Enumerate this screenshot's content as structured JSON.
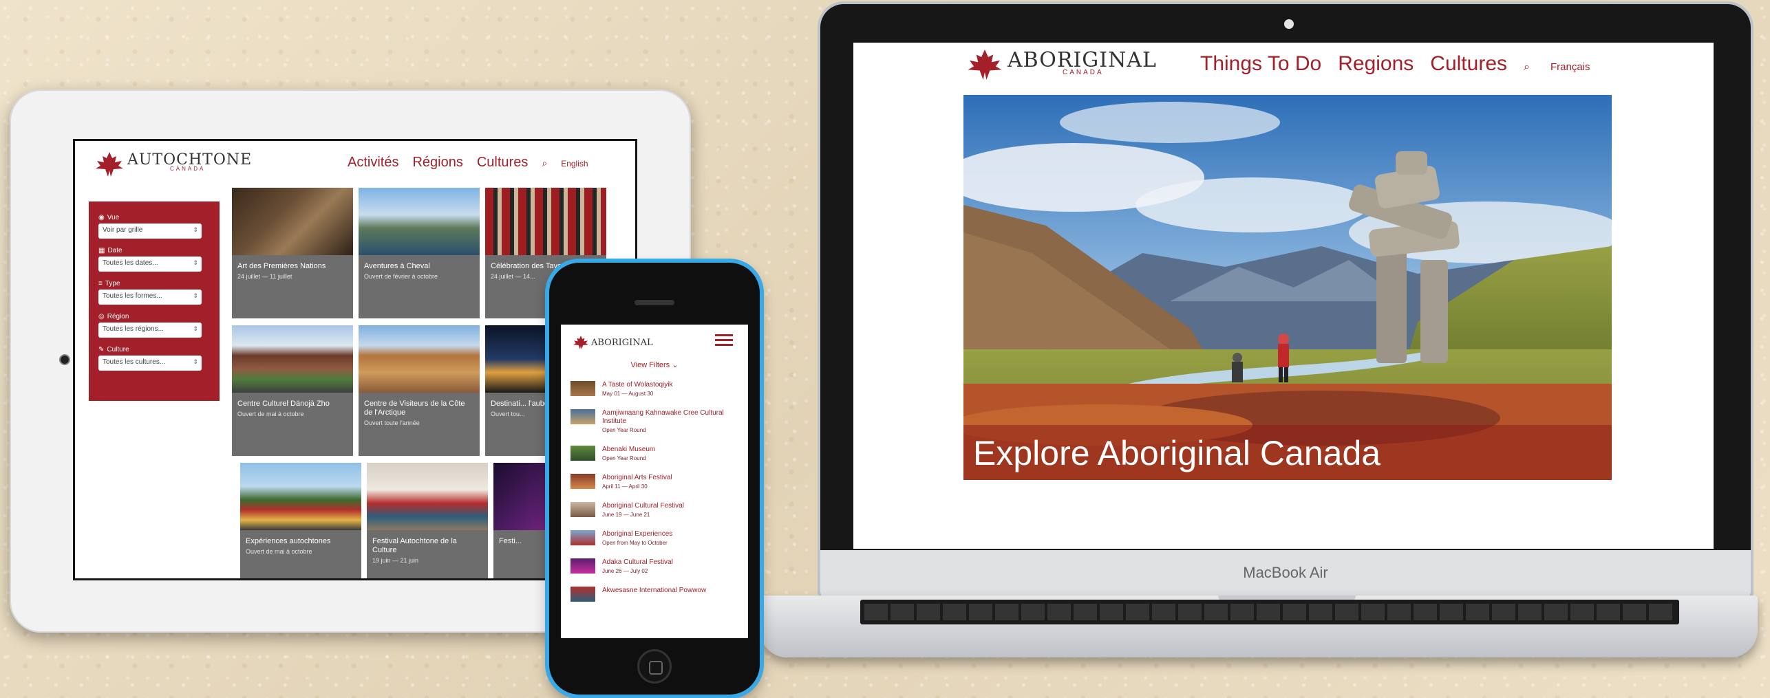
{
  "colors": {
    "brand_red": "#a3202a",
    "phone_frame": "#37a9e6"
  },
  "tablet": {
    "logo": {
      "name": "AUTOCHTONE",
      "sub": "CANADA"
    },
    "nav": {
      "item1": "Activités",
      "item2": "Régions",
      "item3": "Cultures",
      "lang": "English"
    },
    "filters": {
      "vue_label": "Vue",
      "vue_value": "Voir par grille",
      "date_label": "Date",
      "date_value": "Toutes les dates...",
      "type_label": "Type",
      "type_value": "Toutes les formes...",
      "region_label": "Région",
      "region_value": "Toutes les régions...",
      "culture_label": "Culture",
      "culture_value": "Toutes les cultures..."
    },
    "tiles": [
      {
        "title": "Art des Premières Nations",
        "date": "24 juillet — 11 juillet"
      },
      {
        "title": "Aventures à Cheval",
        "date": "Ouvert de février à octobre"
      },
      {
        "title": "Célébration des Tayos",
        "date": "24 juillet — 14..."
      },
      {
        "title": "Centre Culturel Dänojà Zho",
        "date": "Ouvert de mai à octobre"
      },
      {
        "title": "Centre de Visiteurs de la Côte de l'Arctique",
        "date": "Ouvert toute l'année"
      },
      {
        "title": "Destinati... l'auberg...",
        "date": "Ouvert tou..."
      },
      {
        "title": "Expériences autochtones",
        "date": "Ouvert de mai à octobre"
      },
      {
        "title": "Festival Autochtone de la Culture",
        "date": "19 juin — 21 juin"
      },
      {
        "title": "Festi...",
        "date": ""
      }
    ]
  },
  "phone": {
    "logo": "ABORIGINAL",
    "filter": "View Filters",
    "items": [
      {
        "title": "A Taste of Wolastoqiyik",
        "date": "May 01 — August 30"
      },
      {
        "title": "Aamjiwnaang Kahnawake Cree Cultural Institute",
        "date": "Open Year Round"
      },
      {
        "title": "Abenaki Museum",
        "date": "Open Year Round"
      },
      {
        "title": "Aboriginal Arts Festival",
        "date": "April 11 — April 30"
      },
      {
        "title": "Aboriginal Cultural Festival",
        "date": "June 19 — June 21"
      },
      {
        "title": "Aboriginal Experiences",
        "date": "Open from May to October"
      },
      {
        "title": "Adaka Cultural Festival",
        "date": "June 26 — July 02"
      },
      {
        "title": "Akwesasne International Powwow",
        "date": ""
      }
    ]
  },
  "laptop": {
    "logo": {
      "name": "ABORIGINAL",
      "sub": "CANADA"
    },
    "nav": {
      "item1": "Things To Do",
      "item2": "Regions",
      "item3": "Cultures",
      "lang": "Français"
    },
    "hero_text": "Explore Aboriginal Canada",
    "brand": "MacBook Air"
  }
}
